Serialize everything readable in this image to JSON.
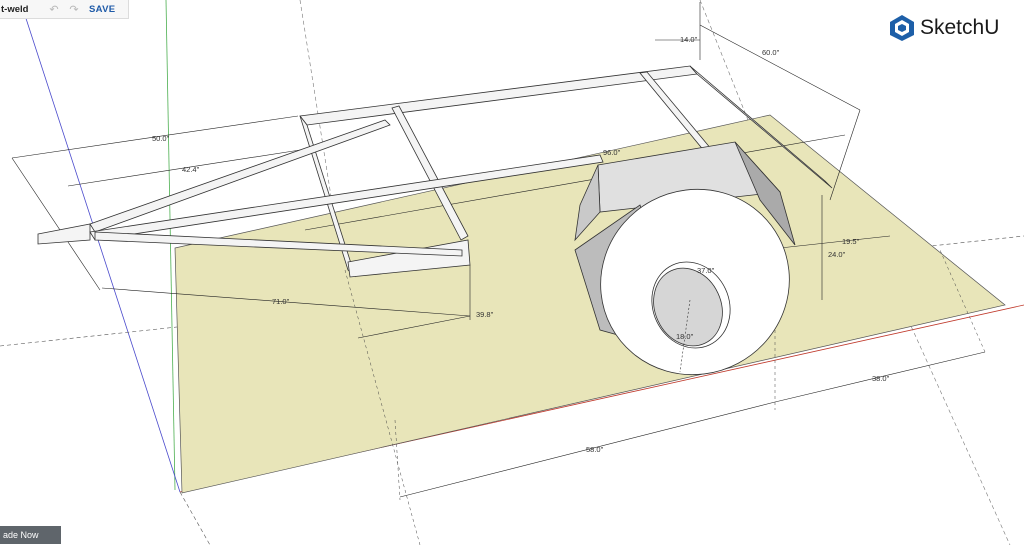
{
  "toolbar": {
    "doc_title": "t-weld",
    "undo_icon": "undo-icon",
    "redo_icon": "redo-icon",
    "save_label": "SAVE"
  },
  "brand": {
    "logo_icon": "sketchup-logo-icon",
    "name": "SketchU"
  },
  "trade_button": {
    "label": "ade Now"
  },
  "model": {
    "ground_color": "#e8e5b9",
    "wheel_color": "#ffffff",
    "fender_color": "#e0e0e0",
    "frame_color": "#f4f4f4"
  },
  "dimensions": {
    "d_14": "14.0\"",
    "d_60": "60.0\"",
    "d_50": "50.0\"",
    "d_42": "42.4\"",
    "d_96": "96.0\"",
    "d_19": "19.5\"",
    "d_24": "24.0\"",
    "d_37": "37.0\"",
    "d_71": "71.0\"",
    "d_39": "39.8\"",
    "d_18": "18.0\"",
    "d_38": "38.0\"",
    "d_58": "58.0\""
  }
}
